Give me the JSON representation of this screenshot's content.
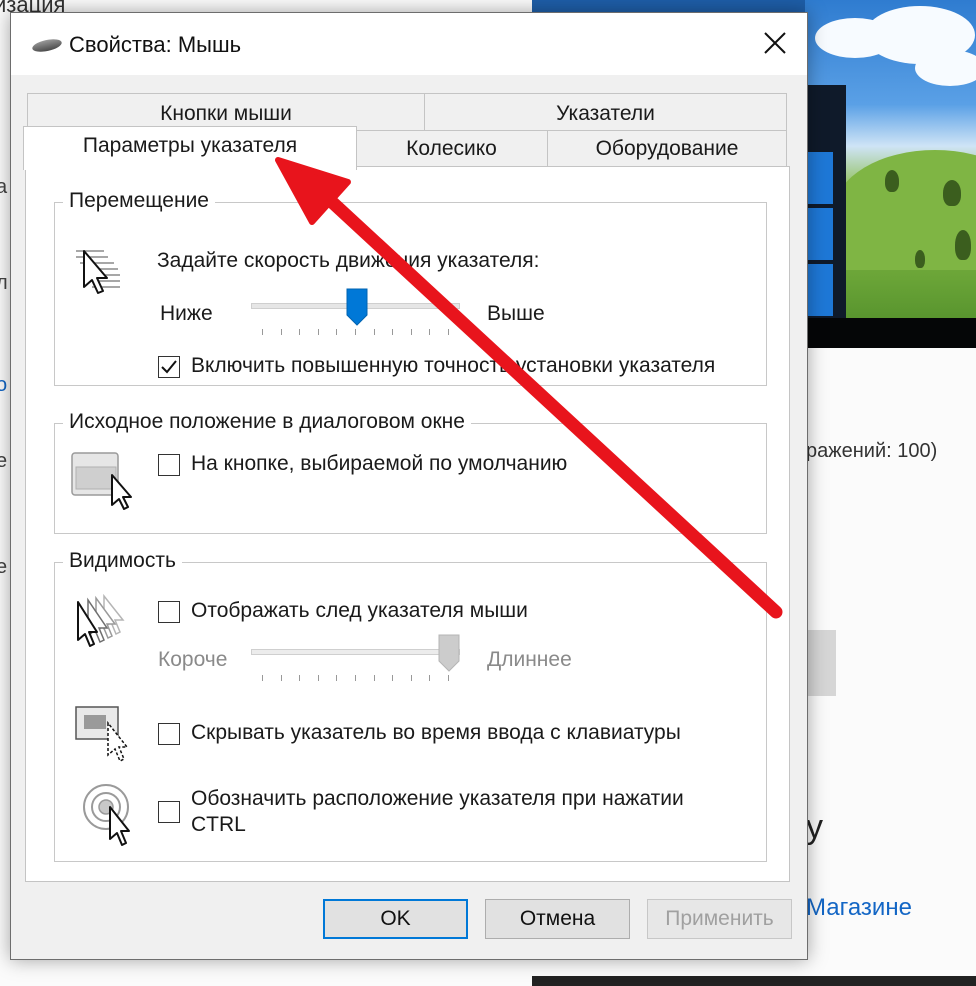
{
  "background": {
    "top_fragment": "изация",
    "scale_text": "ражений: 100)",
    "store_link": "Магазине",
    "side_glyphs": [
      "а",
      "л",
      "е",
      "о",
      "е"
    ],
    "big_glyph": "у"
  },
  "dialog": {
    "title": "Свойства: Мышь",
    "tabs": {
      "row_back": [
        "Кнопки мыши",
        "Указатели"
      ],
      "row_front": [
        "Параметры указателя",
        "Колесико",
        "Оборудование"
      ],
      "selected": "Параметры указателя"
    },
    "motion": {
      "group_title": "Перемещение",
      "speed_label": "Задайте скорость движения указателя:",
      "slower_label": "Ниже",
      "faster_label": "Выше",
      "speed_value": "6 of 11",
      "precision_label": "Включить повышенную точность установки указателя",
      "precision_checked": true
    },
    "snap_to": {
      "group_title": "Исходное положение в диалоговом окне",
      "default_button_label": "На кнопке, выбираемой по умолчанию",
      "checked": false
    },
    "visibility": {
      "group_title": "Видимость",
      "trails_label": "Отображать след указателя мыши",
      "trails_checked": false,
      "short_label": "Короче",
      "long_label": "Длиннее",
      "trail_length_value": "max",
      "hide_label": "Скрывать указатель во время ввода с клавиатуры",
      "hide_checked": false,
      "ctrl_label_line1": "Обозначить расположение указателя при нажатии",
      "ctrl_label_line2": "CTRL",
      "ctrl_checked": false
    },
    "buttons": {
      "ok": "OK",
      "cancel": "Отмена",
      "apply": "Применить"
    }
  },
  "colors": {
    "accent": "#0078d7",
    "annotation_arrow": "#e8141c",
    "slider_thumb": "#0078d7"
  },
  "icons": [
    "mouse-icon",
    "close-icon",
    "checkmark-icon",
    "pointer-speed-icon",
    "snap-to-icon",
    "pointer-trails-icon",
    "hide-pointer-icon",
    "ctrl-locate-icon"
  ]
}
